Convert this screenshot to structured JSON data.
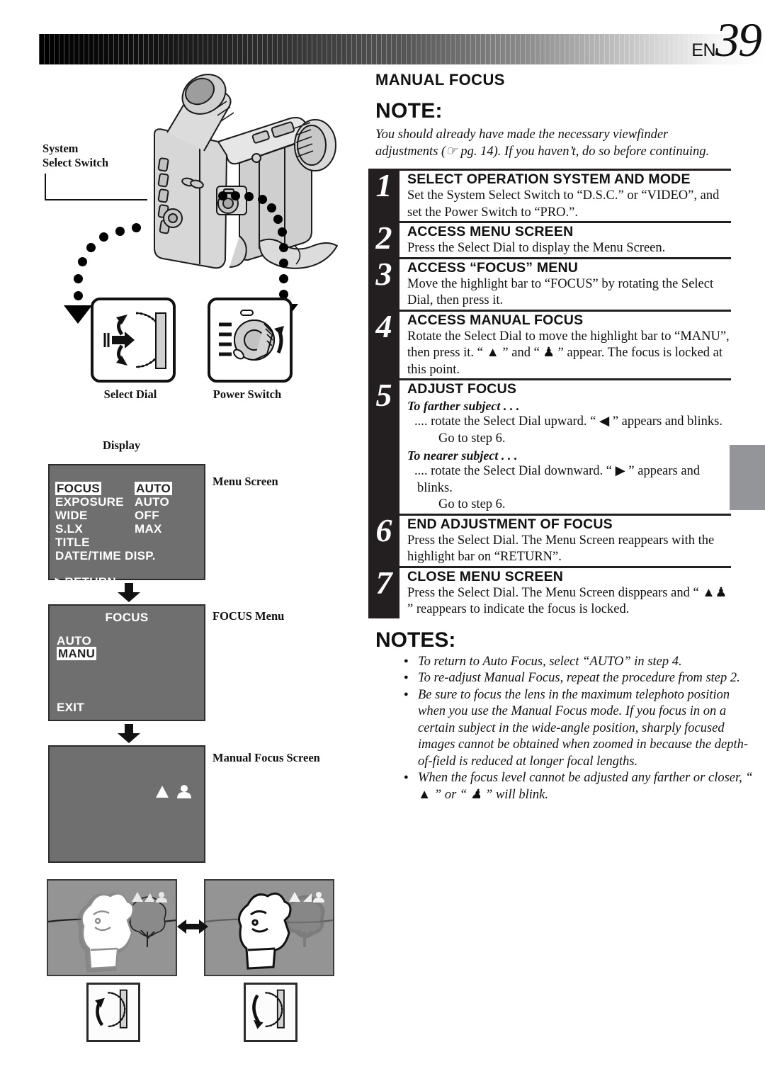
{
  "page": {
    "prefix": "EN",
    "number": "39"
  },
  "left": {
    "callouts": {
      "system_select_switch": "System\nSelect Switch",
      "select_dial": "Select Dial",
      "power_switch": "Power Switch",
      "display": "Display"
    },
    "screens": [
      {
        "caption": "Menu Screen",
        "rows": [
          {
            "label": "FOCUS",
            "label_highlight": true,
            "value": "AUTO",
            "value_highlight": true
          },
          {
            "label": "EXPOSURE",
            "label_highlight": false,
            "value": "AUTO",
            "value_highlight": false
          },
          {
            "label": "WIDE",
            "label_highlight": false,
            "value": "OFF",
            "value_highlight": false
          },
          {
            "label": "S.LX",
            "label_highlight": false,
            "value": "MAX",
            "value_highlight": false
          },
          {
            "label": "TITLE",
            "label_highlight": false,
            "value": "",
            "value_highlight": false
          },
          {
            "label": "DATE/TIME DISP.",
            "label_highlight": false,
            "value": "",
            "value_highlight": false
          }
        ],
        "footer": "▶RETURN"
      },
      {
        "caption": "FOCUS Menu",
        "title": "FOCUS",
        "options": [
          {
            "label": "AUTO",
            "highlight": false
          },
          {
            "label": "MANU",
            "highlight": true
          }
        ],
        "footer": "EXIT"
      },
      {
        "caption": "Manual Focus Screen",
        "indicators": [
          "mountain-icon",
          "person-icon"
        ]
      }
    ],
    "samples": {
      "left_icon": "dial-rotate-up-icon",
      "right_icon": "dial-rotate-down-icon",
      "between": "double-arrow-icon"
    }
  },
  "right": {
    "section_title": "MANUAL FOCUS",
    "note_heading": "NOTE:",
    "note_body": "You should already have made the necessary viewfinder adjustments (☞ pg. 14). If you haven’t, do so before continuing.",
    "steps": [
      {
        "num": "1",
        "title": "SELECT OPERATION SYSTEM AND MODE",
        "text": "Set the System Select Switch to “D.S.C.” or “VIDEO”, and set the Power Switch to “PRO.”."
      },
      {
        "num": "2",
        "title": "ACCESS MENU SCREEN",
        "text": "Press the Select Dial to display the Menu Screen."
      },
      {
        "num": "3",
        "title": "ACCESS “FOCUS” MENU",
        "text": "Move the highlight bar to “FOCUS” by rotating the Select Dial, then press it."
      },
      {
        "num": "4",
        "title": "ACCESS MANUAL FOCUS",
        "text": "Rotate the Select Dial to move the highlight bar to “MANU”, then press it. “ ▲ ” and “ ♟ ” appear. The focus is locked at this point."
      },
      {
        "num": "5",
        "title": "ADJUST FOCUS",
        "sub1_head": "To farther subject . . .",
        "sub1_text": ".... rotate the Select Dial upward. “ ◀ ” appears and blinks.",
        "sub1_goto": "Go to step 6.",
        "sub2_head": "To nearer subject . . .",
        "sub2_text": ".... rotate the Select Dial downward. “ ▶ ” appears and blinks.",
        "sub2_goto": "Go to step 6."
      },
      {
        "num": "6",
        "title": "END ADJUSTMENT OF FOCUS",
        "text": "Press the Select Dial. The Menu Screen reappears with the highlight bar on “RETURN”."
      },
      {
        "num": "7",
        "title": "CLOSE MENU SCREEN",
        "text": "Press the Select Dial. The Menu Screen disppears and “ ▲♟ ” reappears to indicate the focus is locked."
      }
    ],
    "notes_heading": "NOTES:",
    "notes": [
      "To return to Auto Focus, select “AUTO” in step 4.",
      "To re-adjust Manual Focus, repeat the procedure from step 2.",
      "Be sure to focus the lens in the maximum telephoto position when you use the Manual Focus mode. If you focus in on a certain subject in the wide-angle position, sharply focused images cannot be obtained when zoomed in because the depth-of-field is reduced at longer focal lengths.",
      "When the focus level cannot be adjusted any farther or closer, “ ▲ ” or “ ♟ ” will blink."
    ]
  },
  "colors": {
    "ink": "#1a1a1a",
    "step_bar": "#231f20",
    "lcd_bg": "#6f6f6f",
    "photo_bg": "#949494",
    "edge_tab": "#939598"
  }
}
